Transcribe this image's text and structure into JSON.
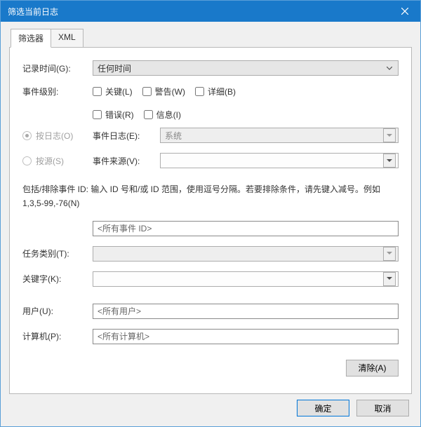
{
  "window": {
    "title": "筛选当前日志"
  },
  "tabs": {
    "filter": "筛选器",
    "xml": "XML"
  },
  "labels": {
    "logged": "记录时间(G):",
    "level": "事件级别:",
    "byLog": "按日志(O)",
    "bySource": "按源(S)",
    "eventLog": "事件日志(E):",
    "eventSrc": "事件来源(V):",
    "help": "包括/排除事件 ID: 输入 ID 号和/或 ID 范围，使用逗号分隔。若要排除条件，请先键入减号。例如 1,3,5-99,-76(N)",
    "task": "任务类别(T):",
    "keyword": "关键字(K):",
    "user": "用户(U):",
    "computer": "计算机(P):"
  },
  "values": {
    "loggedSel": "任何时间",
    "eventLogSel": "系统",
    "eventSrcSel": "",
    "eventId": "<所有事件 ID>",
    "taskSel": "",
    "keywordSel": "",
    "userVal": "<所有用户>",
    "computerVal": "<所有计算机>"
  },
  "levels": {
    "critical": "关键(L)",
    "warning": "警告(W)",
    "verbose": "详细(B)",
    "error": "错误(R)",
    "info": "信息(I)"
  },
  "buttons": {
    "clear": "清除(A)",
    "ok": "确定",
    "cancel": "取消"
  }
}
